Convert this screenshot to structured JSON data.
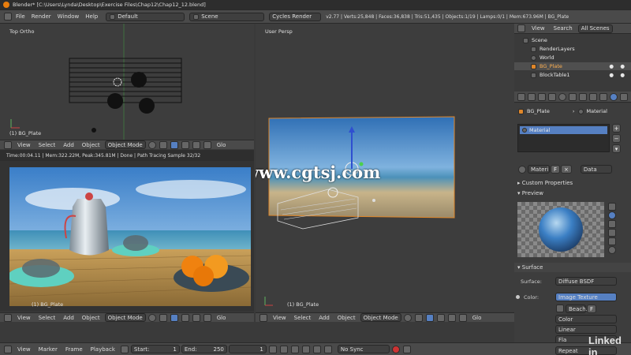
{
  "window_title": "Blender* [C:\\Users\\Lynda\\Desktop\\Exercise Files\\Chap12\\Chap12_12.blend]",
  "menu": [
    "File",
    "Render",
    "Window",
    "Help"
  ],
  "layout_name": "Default",
  "scene_name": "Scene",
  "render_engine": "Cycles Render",
  "stats": "v2.77 | Verts:25,848 | Faces:36,838 | Tris:51,435 | Objects:1/19 | Lamps:0/1 | Mem:673.96M | BG_Plate",
  "top_ortho": {
    "label": "Top Ortho",
    "object": "(1) BG_Plate"
  },
  "user_persp": {
    "label": "User Persp",
    "object": "(1) BG_Plate"
  },
  "render_view": {
    "status": "Time:00:04.11 | Mem:322.22M, Peak:345.81M | Done | Path Tracing Sample 32/32",
    "object": "(1) BG_Plate"
  },
  "watermark": "www.cgtsj.com",
  "brand": "Linked in",
  "view_header": {
    "view": "View",
    "select": "Select",
    "add": "Add",
    "object": "Object",
    "mode": "Object Mode",
    "global": "Glo"
  },
  "outliner": {
    "tabs": [
      "View",
      "Search",
      "All Scenes"
    ],
    "items": [
      "Scene",
      "RenderLayers",
      "World",
      "BG_Plate",
      "BlockTable1"
    ]
  },
  "properties": {
    "object_name": "BG_Plate",
    "tab_material": "Material",
    "slot": "Material",
    "material_field": "Materi",
    "f_button": "F",
    "data_dropdown": "Data",
    "custom_properties": "Custom Properties",
    "preview": "Preview",
    "surface": "Surface",
    "surface_label": "Surface:",
    "surface_value": "Diffuse BSDF",
    "color_label": "Color:",
    "color_value": "Image Texture",
    "image_name": "Beach.",
    "color_mode": "Color",
    "interp": "Linear",
    "projection": "Fla",
    "extension": "Repeat"
  },
  "timeline": {
    "menus": [
      "View",
      "Marker",
      "Frame",
      "Playback"
    ],
    "start_label": "Start:",
    "start": "1",
    "end_label": "End:",
    "end": "250",
    "current": "1",
    "sync": "No Sync"
  }
}
